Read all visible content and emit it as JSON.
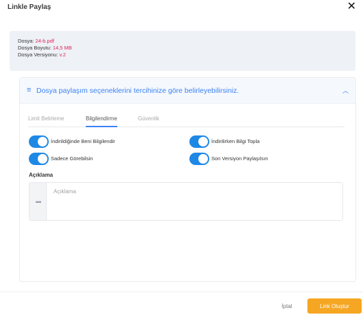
{
  "modal": {
    "title": "Linkle Paylaş",
    "close_symbol": "✕"
  },
  "file_info": {
    "name_label": "Dosya:",
    "name_value": "24-b.pdf",
    "size_label": "Dosya Boyutu:",
    "size_value": "14,5 MB",
    "version_label": "Dosya Versiyonu:",
    "version_value": "v.2"
  },
  "panel": {
    "header_icon": "list-icon",
    "header_text": "Dosya paylaşım seçeneklerini tercihinize göre belirleyebilirsiniz.",
    "collapse_icon": "chevron-up-icon"
  },
  "tabs": [
    {
      "label": "Limit Belirleme",
      "active": false
    },
    {
      "label": "Bilgilendirme",
      "active": true
    },
    {
      "label": "Güvenlik",
      "active": false
    }
  ],
  "toggles": [
    {
      "label": "İndirildiğinde Beni Bilgilendir",
      "on": true
    },
    {
      "label": "İndirilirken Bilgi Topla",
      "on": true
    },
    {
      "label": "Sadece Görebilsin",
      "on": true
    },
    {
      "label": "Son Versiyon Paylaşılsın",
      "on": true
    }
  ],
  "description": {
    "label": "Açıklama",
    "placeholder": "Açıklama",
    "value": "",
    "addon_icon": "comment-icon"
  },
  "footer": {
    "cancel_label": "İptal",
    "submit_label": "Link Oluştur"
  },
  "colors": {
    "accent": "#3b82f6",
    "toggle_on": "#1e88e5",
    "highlight": "#e0245e",
    "primary_button": "#f5a623"
  }
}
